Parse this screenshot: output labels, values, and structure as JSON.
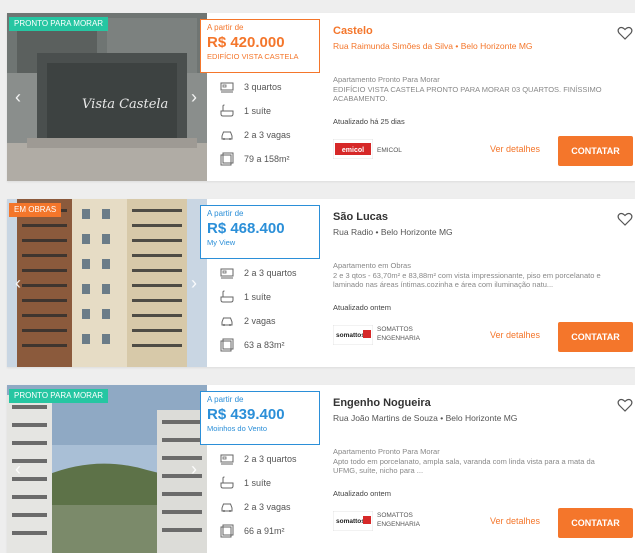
{
  "colors": {
    "orange": "#f4762b",
    "blue": "#2b8fd8",
    "green": "#26c6a2"
  },
  "listings": [
    {
      "badge": "PRONTO PARA MORAR",
      "price_from": "A partir de",
      "price": "R$ 420.000",
      "price_sub": "EDIFÍCIO VISTA CASTELA",
      "title": "Castelo",
      "address": "Rua Raimunda Simões da Silva • Belo Horizonte MG",
      "features": {
        "bedrooms": "3 quartos",
        "suites": "1 suíte",
        "parking": "2 a 3 vagas",
        "area": "79 a 158m²"
      },
      "description": "Apartamento Pronto Para Morar\nEDIFÍCIO VISTA CASTELA PRONTO PARA MORAR 03 QUARTOS. FINÍSSIMO ACABAMENTO.",
      "updated": "Atualizado há 25 dias",
      "builder_logo_text": "emicol",
      "builder": "EMICOL",
      "details": "Ver detalhes",
      "contact": "CONTATAR",
      "image_sign": "Vista Castela"
    },
    {
      "badge": "EM OBRAS",
      "price_from": "A partir de",
      "price": "R$ 468.400",
      "price_sub": "My View",
      "title": "São Lucas",
      "address": "Rua Radio • Belo Horizonte MG",
      "features": {
        "bedrooms": "2 a 3 quartos",
        "suites": "1 suíte",
        "parking": "2 vagas",
        "area": "63 a 83m²"
      },
      "description": "Apartamento em Obras\n2 e 3 qtos - 63,70m² e 83,88m² com vista impressionante, piso em porcelanato e laminado nas áreas íntimas.cozinha e área com iluminação natu...",
      "updated": "Atualizado ontem",
      "builder_logo_text": "somattos",
      "builder": "SOMATTOS\nENGENHARIA",
      "details": "Ver detalhes",
      "contact": "CONTATAR"
    },
    {
      "badge": "PRONTO PARA MORAR",
      "price_from": "A partir de",
      "price": "R$ 439.400",
      "price_sub": "Moinhos do Vento",
      "title": "Engenho Nogueira",
      "address": "Rua João Martins de Souza • Belo Horizonte MG",
      "features": {
        "bedrooms": "2 a 3 quartos",
        "suites": "1 suíte",
        "parking": "2 a 3 vagas",
        "area": "66 a 91m²"
      },
      "description": "Apartamento Pronto Para Morar\nApto todo em porcelanato, ampla sala, varanda com linda vista para a mata da UFMG, suíte, nicho para ...",
      "updated": "Atualizado ontem",
      "builder_logo_text": "somattos",
      "builder": "SOMATTOS\nENGENHARIA",
      "details": "Ver detalhes",
      "contact": "CONTATAR"
    }
  ]
}
